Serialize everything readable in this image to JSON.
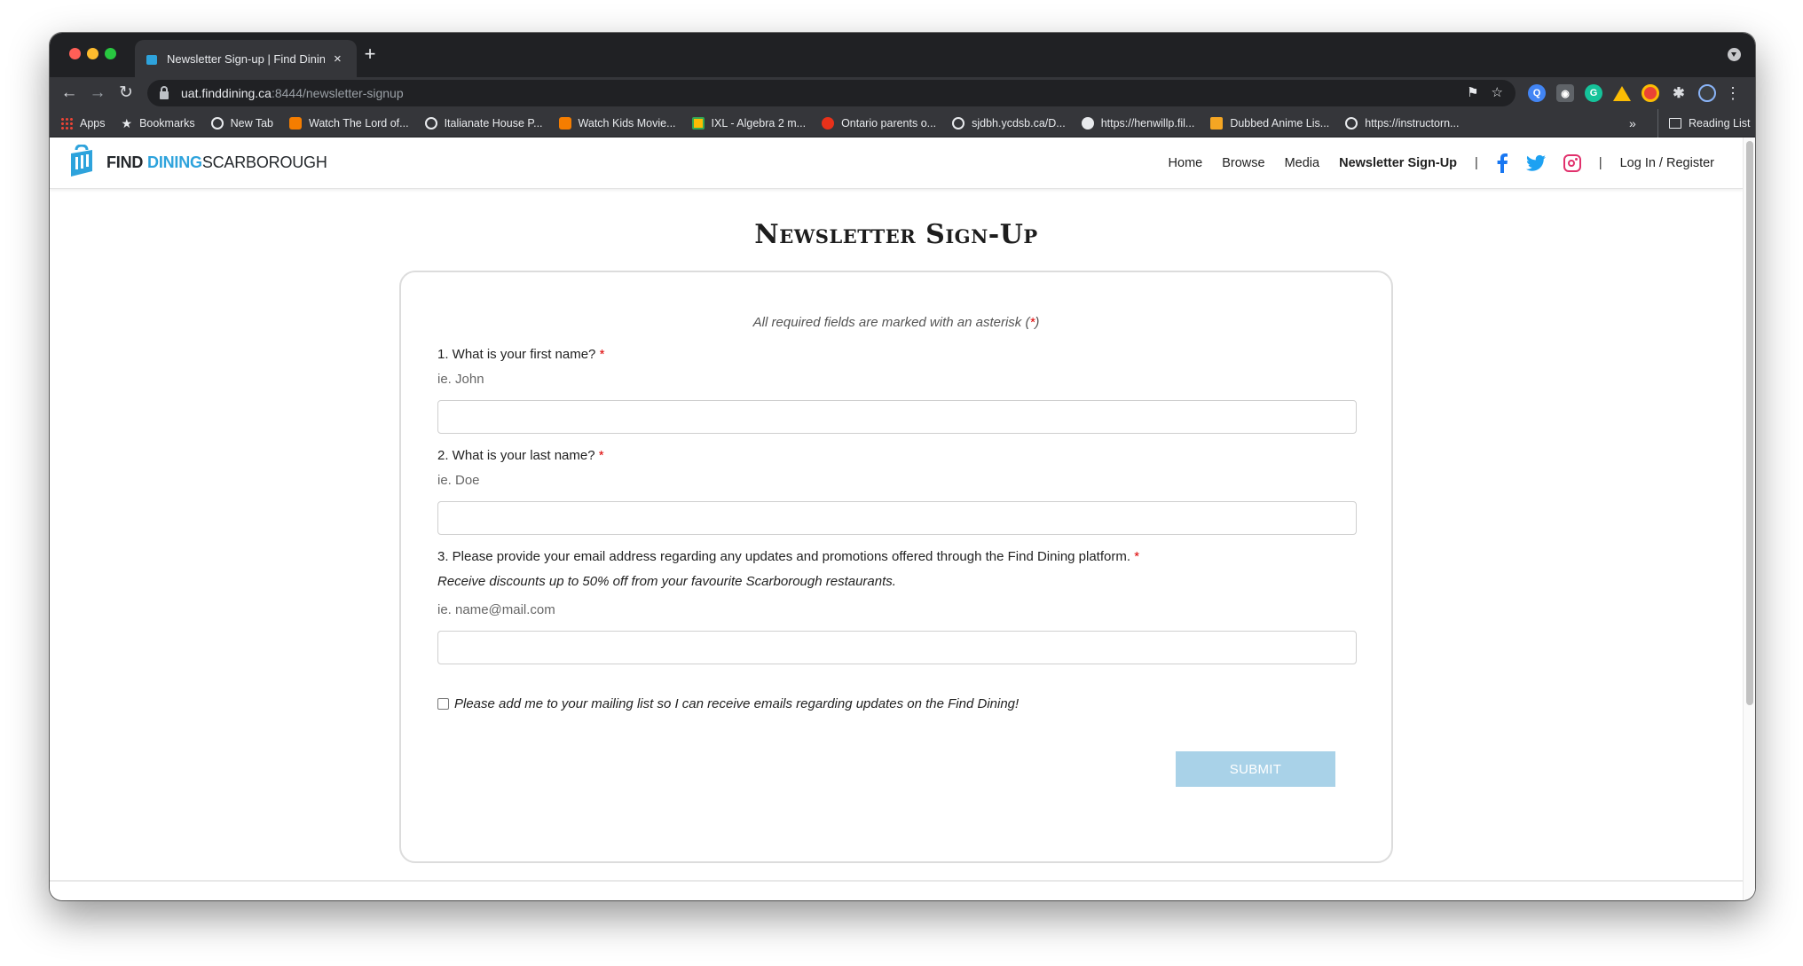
{
  "browser": {
    "tab_title": "Newsletter Sign-up | Find Dining Scarborough",
    "tab_close": "×",
    "new_tab": "+",
    "url_host": "uat.finddining.ca",
    "url_rest": ":8444/newsletter-signup",
    "bookmarks": [
      {
        "label": "Apps",
        "icon": "apps-icon"
      },
      {
        "label": "Bookmarks",
        "icon": "star-icon"
      },
      {
        "label": "New Tab",
        "icon": "globe-icon"
      },
      {
        "label": "Watch The Lord of...",
        "icon": "blogger-icon"
      },
      {
        "label": "Italianate House P...",
        "icon": "globe-icon"
      },
      {
        "label": "Watch Kids Movie...",
        "icon": "blogger-icon"
      },
      {
        "label": "IXL - Algebra 2 m...",
        "icon": "ixl-icon"
      },
      {
        "label": "Ontario parents o...",
        "icon": "cbc-icon"
      },
      {
        "label": "sjdbh.ycdsb.ca/D...",
        "icon": "globe-icon"
      },
      {
        "label": "https://henwillp.fil...",
        "icon": "wordpress-icon"
      },
      {
        "label": "Dubbed Anime Lis...",
        "icon": "crunchyroll-icon"
      },
      {
        "label": "https://instructorn...",
        "icon": "globe-icon"
      }
    ],
    "bookmarks_more": "»",
    "reading_list": "Reading List"
  },
  "site": {
    "logo": {
      "find": "FIND",
      "dining": "DINING",
      "scarborough": "SCARBOROUGH"
    },
    "nav": {
      "home": "Home",
      "browse": "Browse",
      "media": "Media",
      "newsletter": "Newsletter Sign-Up",
      "separator": "|",
      "login": "Log In / Register"
    },
    "colors": {
      "brand": "#2ea3dc",
      "facebook": "#1877f2",
      "twitter": "#1da1f2",
      "instagram": "#e1306c"
    }
  },
  "page": {
    "title": "Newsletter Sign-Up",
    "required_note_prefix": "All required fields are marked with an asterisk (",
    "required_note_star": "*",
    "required_note_suffix": ")",
    "required_star": "*",
    "q1": {
      "label": "1. What is your first name?",
      "hint": "ie. John",
      "value": ""
    },
    "q2": {
      "label": "2. What is your last name?",
      "hint": "ie. Doe",
      "value": ""
    },
    "q3": {
      "label": "3. Please provide your email address regarding any updates and promotions offered through the Find Dining platform.",
      "description": "Receive discounts up to 50% off from your favourite Scarborough restaurants.",
      "hint": "ie. name@mail.com",
      "value": ""
    },
    "mailing_list": "Please add me to your mailing list so I can receive emails regarding updates on the Find Dining!",
    "submit": "SUBMIT"
  }
}
